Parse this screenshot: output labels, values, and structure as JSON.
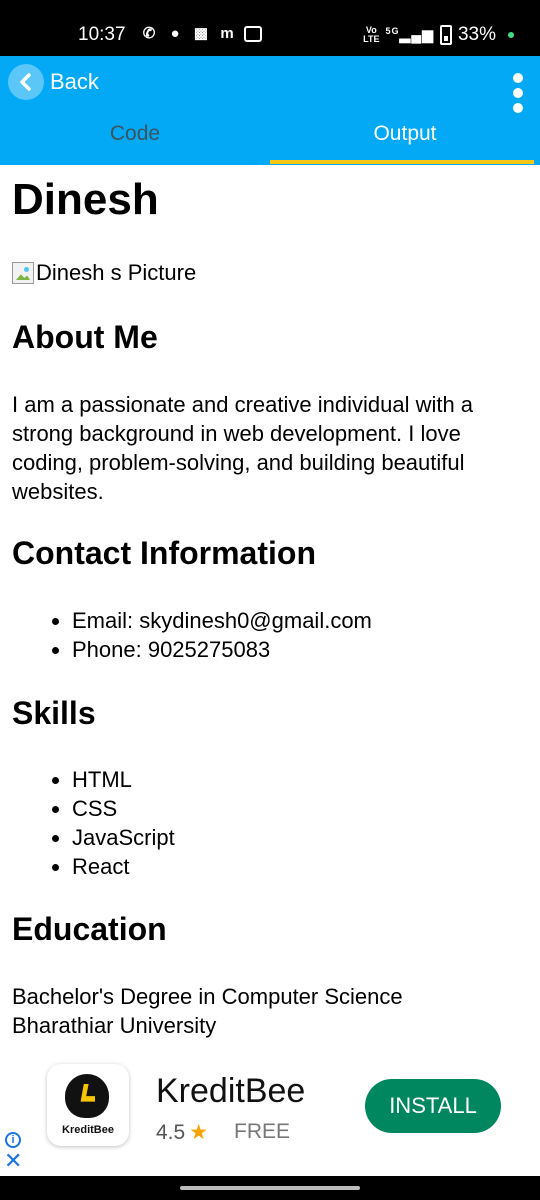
{
  "status_bar": {
    "time": "10:37",
    "network_top": "Vo",
    "network_bottom": "LTE",
    "signal": "5G",
    "battery": "33%"
  },
  "app_bar": {
    "back_label": "Back",
    "tabs": [
      {
        "label": "Code",
        "active": false
      },
      {
        "label": "Output",
        "active": true
      }
    ],
    "accent_color": "#03a9f4",
    "indicator_color": "#f5c518"
  },
  "output": {
    "name": "Dinesh",
    "picture_alt": "Dinesh s Picture",
    "about": {
      "heading": "About Me",
      "text": "I am a passionate and creative individual with a strong background in web development. I love coding, problem-solving, and building beautiful websites."
    },
    "contact": {
      "heading": "Contact Information",
      "items": [
        "Email: skydinesh0@gmail.com",
        "Phone: 9025275083"
      ]
    },
    "skills": {
      "heading": "Skills",
      "items": [
        "HTML",
        "CSS",
        "JavaScript",
        "React"
      ]
    },
    "education": {
      "heading": "Education",
      "degree": "Bachelor's Degree in Computer Science",
      "university": "Bharathiar University"
    }
  },
  "ad": {
    "logo_text": "KreditBee",
    "app_name": "KreditBee",
    "rating": "4.5",
    "price": "FREE",
    "install_label": "INSTALL",
    "install_color": "#01875f"
  }
}
